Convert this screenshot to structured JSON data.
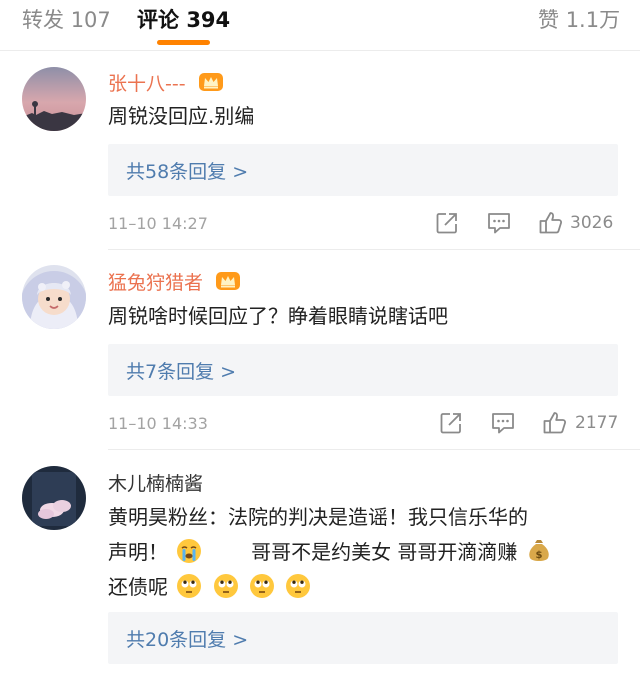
{
  "tabs": {
    "repost_label": "转发",
    "repost_count": "107",
    "comment_label": "评论",
    "comment_count": "394",
    "like_label": "赞",
    "like_count": "1.1万"
  },
  "comments": [
    {
      "user": "张十八---",
      "text": "周锐没回应.别编",
      "replies": "共58条回复 >",
      "time": "11–10 14:27",
      "likes": "3026"
    },
    {
      "user": "猛兔狩猎者",
      "text": "周锐啥时候回应了？睁着眼睛说瞎话吧",
      "replies": "共7条回复 >",
      "time": "11–10 14:33",
      "likes": "2177"
    },
    {
      "user": "木儿楠楠酱",
      "text_line1": "黄明昊粉丝：法院的判决是造谣！我只信乐华的",
      "text_line2a": "声明！",
      "text_line2b": "哥哥不是约美女 哥哥开滴滴赚",
      "text_line3": "还债呢",
      "replies": "共20条回复 >"
    }
  ],
  "colors": {
    "accent": "#ff8200",
    "vip_name": "#eb7350",
    "reply_link": "#4f7cae"
  },
  "icons": [
    "crown-icon",
    "share-icon",
    "comment-icon",
    "like-icon",
    "crying-emoji-icon",
    "money-bag-icon",
    "eye-roll-emoji-icon"
  ]
}
